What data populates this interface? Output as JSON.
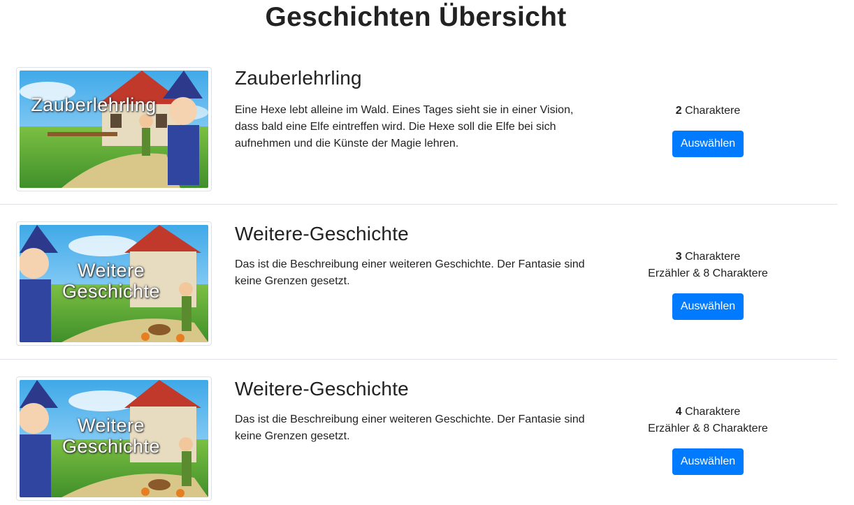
{
  "page": {
    "title": "Geschichten Übersicht"
  },
  "stories": [
    {
      "title": "Zauberlehrling",
      "thumbnail_caption": "Zauberlehrling",
      "description": "Eine Hexe lebt alleine im Wald. Eines Tages sieht sie in einer Vision, dass bald eine Elfe eintreffen wird. Die Hexe soll die Elfe bei sich aufnehmen und die Künste der Magie lehren.",
      "character_count": "2",
      "character_label": "Charaktere",
      "extra": "",
      "button_label": "Auswählen"
    },
    {
      "title": "Weitere-Geschichte",
      "thumbnail_caption_line1": "Weitere",
      "thumbnail_caption_line2": "Geschichte",
      "description": "Das ist die Beschreibung einer weiteren Geschichte. Der Fantasie sind keine Grenzen gesetzt.",
      "character_count": "3",
      "character_label": "Charaktere",
      "extra": "Erzähler & 8 Charaktere",
      "button_label": "Auswählen"
    },
    {
      "title": "Weitere-Geschichte",
      "thumbnail_caption_line1": "Weitere",
      "thumbnail_caption_line2": "Geschichte",
      "description": "Das ist die Beschreibung einer weiteren Geschichte. Der Fantasie sind keine Grenzen gesetzt.",
      "character_count": "4",
      "character_label": "Charaktere",
      "extra": "Erzähler & 8 Charaktere",
      "button_label": "Auswählen"
    }
  ],
  "colors": {
    "primary": "#007bff",
    "divider": "#dee2e6",
    "text": "#212529"
  }
}
